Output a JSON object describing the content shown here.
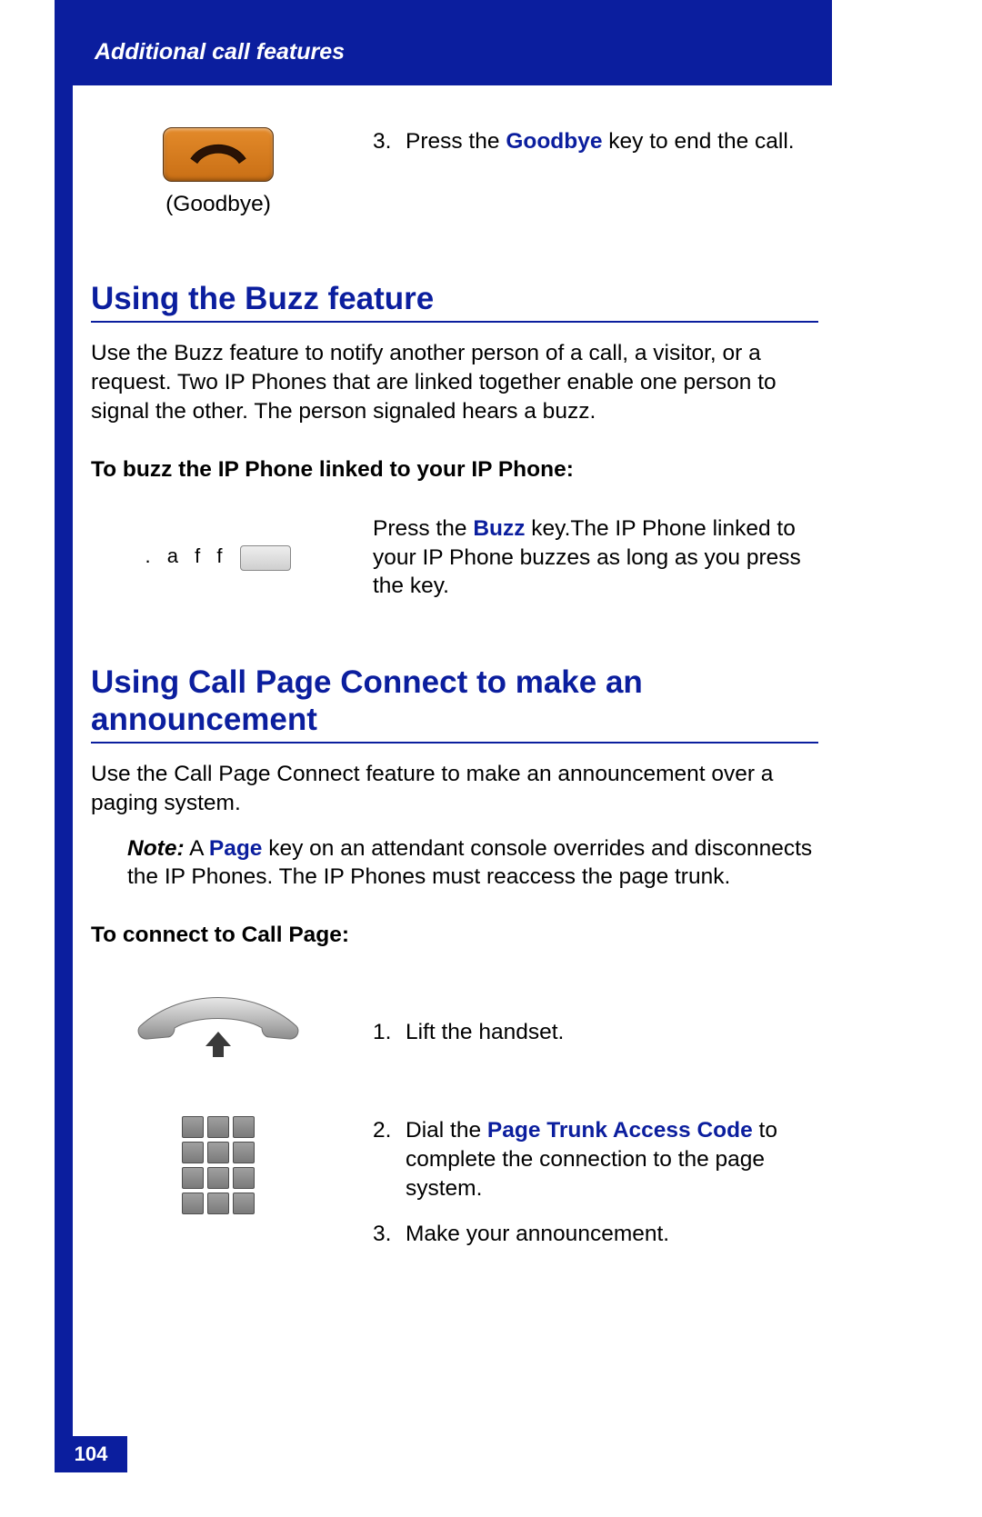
{
  "header": {
    "title": "Additional call features"
  },
  "page_number": "104",
  "step3": {
    "caption": "(Goodbye)",
    "num": "3.",
    "text_a": "Press the ",
    "key": "Goodbye",
    "text_b": " key to end the call."
  },
  "buzz": {
    "heading": "Using the Buzz feature",
    "para": "Use the Buzz feature to notify another person of a call, a visitor, or a request. Two IP Phones that are linked together enable one person to signal the other. The person signaled hears a buzz.",
    "sub": "To buzz the IP Phone linked to your IP Phone:",
    "aff": ". a f f",
    "text_a": "Press the ",
    "key": "Buzz",
    "text_b": " key.The IP Phone linked to your IP Phone buzzes as long as you press the key."
  },
  "page": {
    "heading": "Using Call Page Connect to make an announcement",
    "para": "Use the Call Page Connect feature to make an announcement over a paging system.",
    "note_label": "Note:",
    "note_a": " A ",
    "note_key": "Page",
    "note_b": " key on an attendant console overrides and disconnects the IP Phones. The IP Phones must reaccess the page trunk.",
    "sub": "To connect to Call Page:",
    "s1": {
      "num": "1.",
      "text": "Lift the handset."
    },
    "s2": {
      "num": "2.",
      "a": "Dial the ",
      "key": "Page Trunk Access Code",
      "b": " to complete the connection to the page system."
    },
    "s3": {
      "num": "3.",
      "text": "Make your announcement."
    }
  }
}
